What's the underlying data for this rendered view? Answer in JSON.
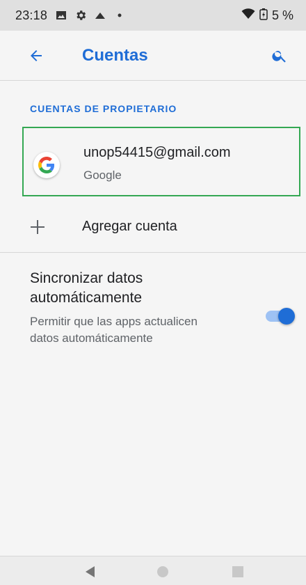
{
  "status_bar": {
    "time": "23:18",
    "battery_text": "5 %",
    "icons": [
      "image-icon",
      "gear-icon",
      "triangle-icon",
      "dot-icon",
      "wifi-icon",
      "battery-charging-icon"
    ]
  },
  "app_bar": {
    "title": "Cuentas",
    "back_icon": "arrow-left-icon",
    "search_icon": "search-icon"
  },
  "section": {
    "header": "CUENTAS DE PROPIETARIO"
  },
  "account": {
    "email": "unop54415@gmail.com",
    "type": "Google",
    "icon": "google-icon"
  },
  "add_account": {
    "label": "Agregar cuenta",
    "icon": "plus-icon"
  },
  "sync": {
    "title": "Sincronizar datos automáticamente",
    "description": "Permitir que las apps actualicen datos automáticamente",
    "enabled": true
  },
  "nav_bar": {
    "back_icon": "nav-back-icon",
    "home_icon": "nav-home-icon",
    "recents_icon": "nav-recents-icon"
  },
  "colors": {
    "accent": "#1f6dd6",
    "highlight_border": "#34a853",
    "background": "#f5f5f5"
  }
}
